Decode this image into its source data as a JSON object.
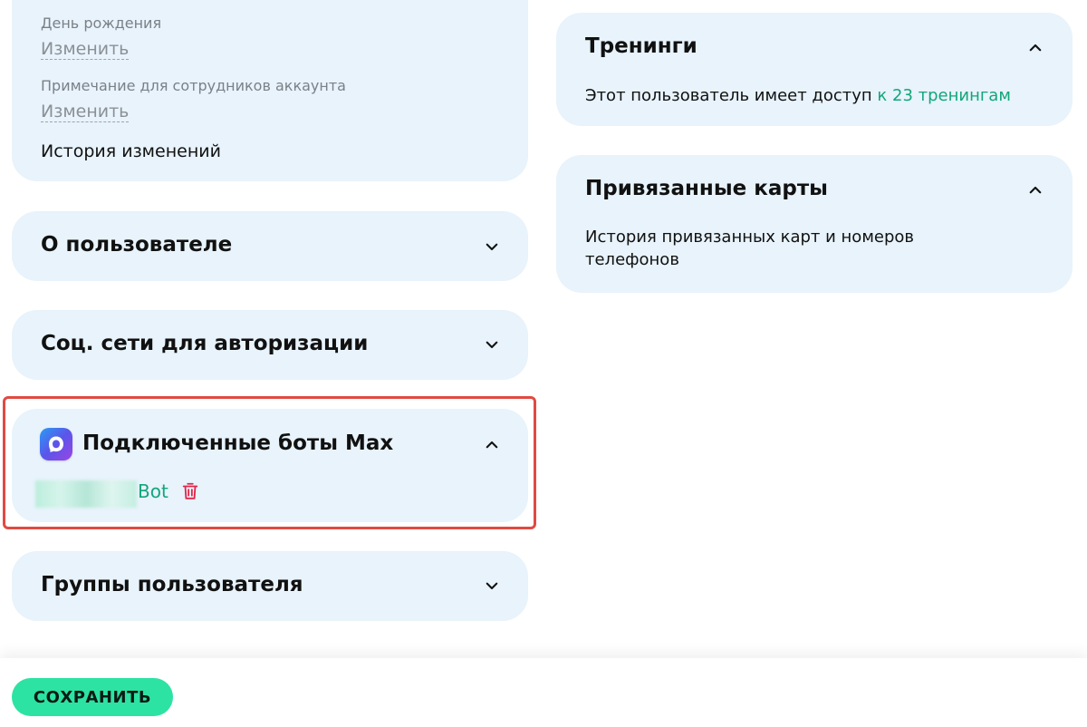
{
  "left_column": {
    "profile_fields": {
      "birthday_label": "День рождения",
      "birthday_action": "Изменить",
      "note_label": "Примечание для сотрудников аккаунта",
      "note_action": "Изменить",
      "history_link": "История изменений"
    },
    "about_user": {
      "title": "О пользователе",
      "state": "collapsed"
    },
    "social_auth": {
      "title": "Соц. сети для авторизации",
      "state": "collapsed"
    },
    "max_bots": {
      "title": "Подключенные боты Max",
      "state": "expanded",
      "bot_suffix": "Bot",
      "highlight_color": "#e14a42"
    },
    "user_groups": {
      "title": "Группы пользователя",
      "state": "collapsed"
    }
  },
  "right_column": {
    "trainings": {
      "title": "Тренинги",
      "state": "expanded",
      "text": "Этот пользователь имеет доступ ",
      "link": "к 23 тренингам"
    },
    "linked_cards": {
      "title": "Привязанные карты",
      "state": "expanded",
      "link": "История привязанных карт и номеров телефонов"
    }
  },
  "footer": {
    "save_label": "СОХРАНИТЬ"
  },
  "colors": {
    "card_bg": "#e8f3fb",
    "accent_green": "#12a67a",
    "button_green": "#2ce3a3",
    "trash_red": "#e0264a"
  }
}
